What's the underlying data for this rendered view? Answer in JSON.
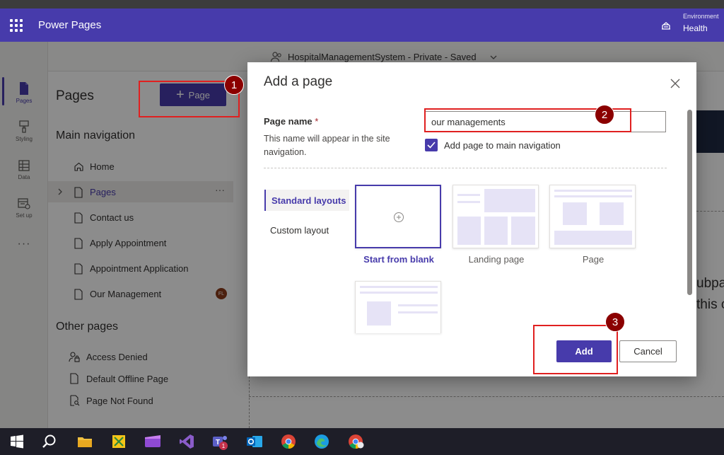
{
  "topbar": {
    "app_title": "Power Pages",
    "environment_label": "Environment",
    "environment_name": "Health"
  },
  "site_header": {
    "site_name": "HospitalManagementSystem - Private - Saved"
  },
  "rail": {
    "items": [
      {
        "label": "Pages",
        "icon": "page-icon"
      },
      {
        "label": "Styling",
        "icon": "paintbrush-icon"
      },
      {
        "label": "Data",
        "icon": "table-icon"
      },
      {
        "label": "Set up",
        "icon": "setup-icon"
      }
    ],
    "more": "···"
  },
  "pages_panel": {
    "title": "Pages",
    "add_button": "Page",
    "main_nav_heading": "Main navigation",
    "main_nav": [
      {
        "label": "Home",
        "icon": "home-icon"
      },
      {
        "label": "Pages",
        "icon": "page-icon",
        "selected": true,
        "more": "···"
      },
      {
        "label": "Contact us",
        "icon": "page-icon"
      },
      {
        "label": "Apply Appointment",
        "icon": "page-icon"
      },
      {
        "label": "Appointment Application",
        "icon": "page-icon"
      },
      {
        "label": "Our Management",
        "icon": "page-icon",
        "avatar": "FL"
      }
    ],
    "other_heading": "Other pages",
    "other_pages": [
      {
        "label": "Access Denied",
        "icon": "person-lock-icon"
      },
      {
        "label": "Default Offline Page",
        "icon": "page-icon"
      },
      {
        "label": "Page Not Found",
        "icon": "page-search-icon"
      }
    ]
  },
  "canvas_text": {
    "frag1": "ubpa",
    "frag2": "this c"
  },
  "dialog": {
    "title": "Add a page",
    "page_name_label": "Page name",
    "required_mark": "*",
    "page_name_help": "This name will appear in the site navigation.",
    "page_name_value": "our managements",
    "add_to_nav_label": "Add page to main navigation",
    "add_to_nav_checked": true,
    "layout_tabs": [
      "Standard layouts",
      "Custom layout"
    ],
    "layouts": [
      {
        "label": "Start from blank",
        "selected": true
      },
      {
        "label": "Landing page",
        "selected": false
      },
      {
        "label": "Page",
        "selected": false
      },
      {
        "label": "",
        "selected": false
      }
    ],
    "add_button": "Add",
    "cancel_button": "Cancel"
  },
  "annotations": {
    "badge1": "1",
    "badge2": "2",
    "badge3": "3",
    "color": "#e02020",
    "badge_color": "#8b0000"
  },
  "colors": {
    "brand": "#473bab",
    "topbar": "#473bab",
    "taskbar": "#1e1e28"
  },
  "taskbar": {
    "icons": [
      "windows-start-icon",
      "search-icon",
      "file-explorer-icon",
      "snipping-tool-icon",
      "video-editor-icon",
      "visual-studio-icon",
      "teams-icon",
      "outlook-icon",
      "chrome-icon",
      "edge-icon",
      "chrome-profile-icon"
    ],
    "teams_badge": "1"
  }
}
